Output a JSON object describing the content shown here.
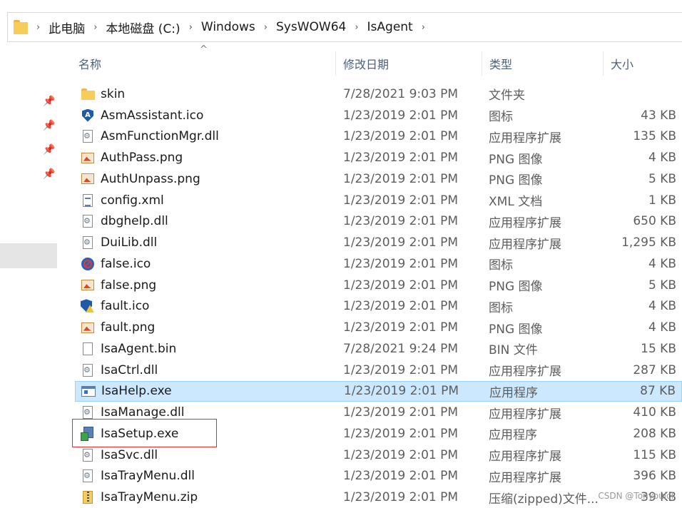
{
  "address_bar": {
    "breadcrumbs": [
      "此电脑",
      "本地磁盘 (C:)",
      "Windows",
      "SysWOW64",
      "IsAgent"
    ],
    "separator": "›"
  },
  "columns": {
    "name": "名称",
    "date": "修改日期",
    "type": "类型",
    "size": "大小",
    "sort_indicator": "^"
  },
  "files": [
    {
      "name": "skin",
      "date": "7/28/2021 9:03 PM",
      "type": "文件夹",
      "size": "",
      "icon": "folder-icon"
    },
    {
      "name": "AsmAssistant.ico",
      "date": "1/23/2019 2:01 PM",
      "type": "图标",
      "size": "43 KB",
      "icon": "shield-a-icon"
    },
    {
      "name": "AsmFunctionMgr.dll",
      "date": "1/23/2019 2:01 PM",
      "type": "应用程序扩展",
      "size": "135 KB",
      "icon": "dll-icon"
    },
    {
      "name": "AuthPass.png",
      "date": "1/23/2019 2:01 PM",
      "type": "PNG 图像",
      "size": "4 KB",
      "icon": "image-icon"
    },
    {
      "name": "AuthUnpass.png",
      "date": "1/23/2019 2:01 PM",
      "type": "PNG 图像",
      "size": "5 KB",
      "icon": "image-icon"
    },
    {
      "name": "config.xml",
      "date": "1/23/2019 2:01 PM",
      "type": "XML 文档",
      "size": "1 KB",
      "icon": "xml-icon"
    },
    {
      "name": "dbghelp.dll",
      "date": "1/23/2019 2:01 PM",
      "type": "应用程序扩展",
      "size": "650 KB",
      "icon": "dll-icon"
    },
    {
      "name": "DuiLib.dll",
      "date": "1/23/2019 2:01 PM",
      "type": "应用程序扩展",
      "size": "1,295 KB",
      "icon": "dll-icon"
    },
    {
      "name": "false.ico",
      "date": "1/23/2019 2:01 PM",
      "type": "图标",
      "size": "4 KB",
      "icon": "stop-icon"
    },
    {
      "name": "false.png",
      "date": "1/23/2019 2:01 PM",
      "type": "PNG 图像",
      "size": "5 KB",
      "icon": "image-icon"
    },
    {
      "name": "fault.ico",
      "date": "1/23/2019 2:01 PM",
      "type": "图标",
      "size": "4 KB",
      "icon": "warning-shield-icon"
    },
    {
      "name": "fault.png",
      "date": "1/23/2019 2:01 PM",
      "type": "PNG 图像",
      "size": "4 KB",
      "icon": "image-icon"
    },
    {
      "name": "IsaAgent.bin",
      "date": "7/28/2021 9:24 PM",
      "type": "BIN 文件",
      "size": "15 KB",
      "icon": "blank-file-icon"
    },
    {
      "name": "IsaCtrl.dll",
      "date": "1/23/2019 2:01 PM",
      "type": "应用程序扩展",
      "size": "287 KB",
      "icon": "dll-icon"
    },
    {
      "name": "IsaHelp.exe",
      "date": "1/23/2019 2:01 PM",
      "type": "应用程序",
      "size": "87 KB",
      "icon": "application-icon",
      "selected": true
    },
    {
      "name": "IsaManage.dll",
      "date": "1/23/2019 2:01 PM",
      "type": "应用程序扩展",
      "size": "410 KB",
      "icon": "dll-icon"
    },
    {
      "name": "IsaSetup.exe",
      "date": "1/23/2019 2:01 PM",
      "type": "应用程序",
      "size": "208 KB",
      "icon": "setup-icon",
      "highlighted": true
    },
    {
      "name": "IsaSvc.dll",
      "date": "1/23/2019 2:01 PM",
      "type": "应用程序扩展",
      "size": "115 KB",
      "icon": "dll-icon"
    },
    {
      "name": "IsaTrayMenu.dll",
      "date": "1/23/2019 2:01 PM",
      "type": "应用程序扩展",
      "size": "396 KB",
      "icon": "dll-icon"
    },
    {
      "name": "IsaTrayMenu.zip",
      "date": "1/23/2019 2:01 PM",
      "type": "压缩(zipped)文件...",
      "size": "39 KB",
      "icon": "zip-icon"
    }
  ],
  "watermark": "CSDN @Tonyoulcl",
  "colors": {
    "selected_row_bg": "#cce8ff",
    "selected_row_border": "#99d1ff",
    "highlight_box": "#e02e2e",
    "header_text": "#4c607a"
  }
}
